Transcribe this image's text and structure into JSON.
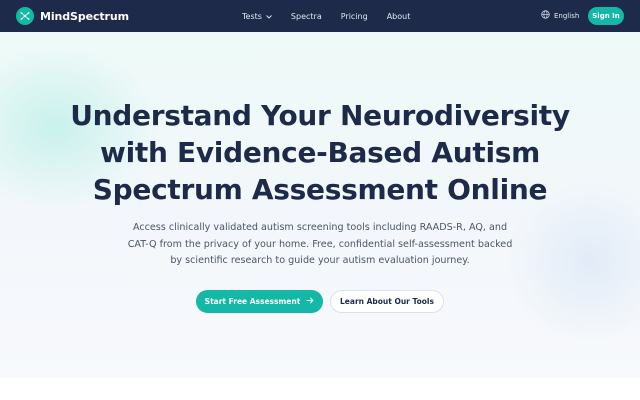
{
  "nav": {
    "brand": "MindSpectrum",
    "brand_icon": "sparkle-logo-icon",
    "links": [
      {
        "label": "Tests",
        "has_dropdown": true
      },
      {
        "label": "Spectra",
        "has_dropdown": false
      },
      {
        "label": "Pricing",
        "has_dropdown": false
      },
      {
        "label": "About",
        "has_dropdown": false
      }
    ],
    "language": "English",
    "language_icon": "globe-icon",
    "signin": "Sign In"
  },
  "hero": {
    "title_lines": [
      "Understand Your Neurodiversity",
      "with Evidence-Based Autism",
      "Spectrum Assessment Online"
    ],
    "subtitle_lines": [
      "Access clinically validated autism screening tools including RAADS-R, AQ, and",
      "CAT-Q from the privacy of your home. Free, confidential self-assessment backed",
      "by scientific research to guide your autism evaluation journey."
    ],
    "cta_primary": "Start Free Assessment",
    "cta_primary_icon": "arrow-right-icon",
    "cta_secondary": "Learn About Our Tools"
  },
  "colors": {
    "nav_bg": "#1e2a4a",
    "accent": "#14b8a6",
    "title": "#1e2a4a",
    "body_text": "#4b5568"
  }
}
